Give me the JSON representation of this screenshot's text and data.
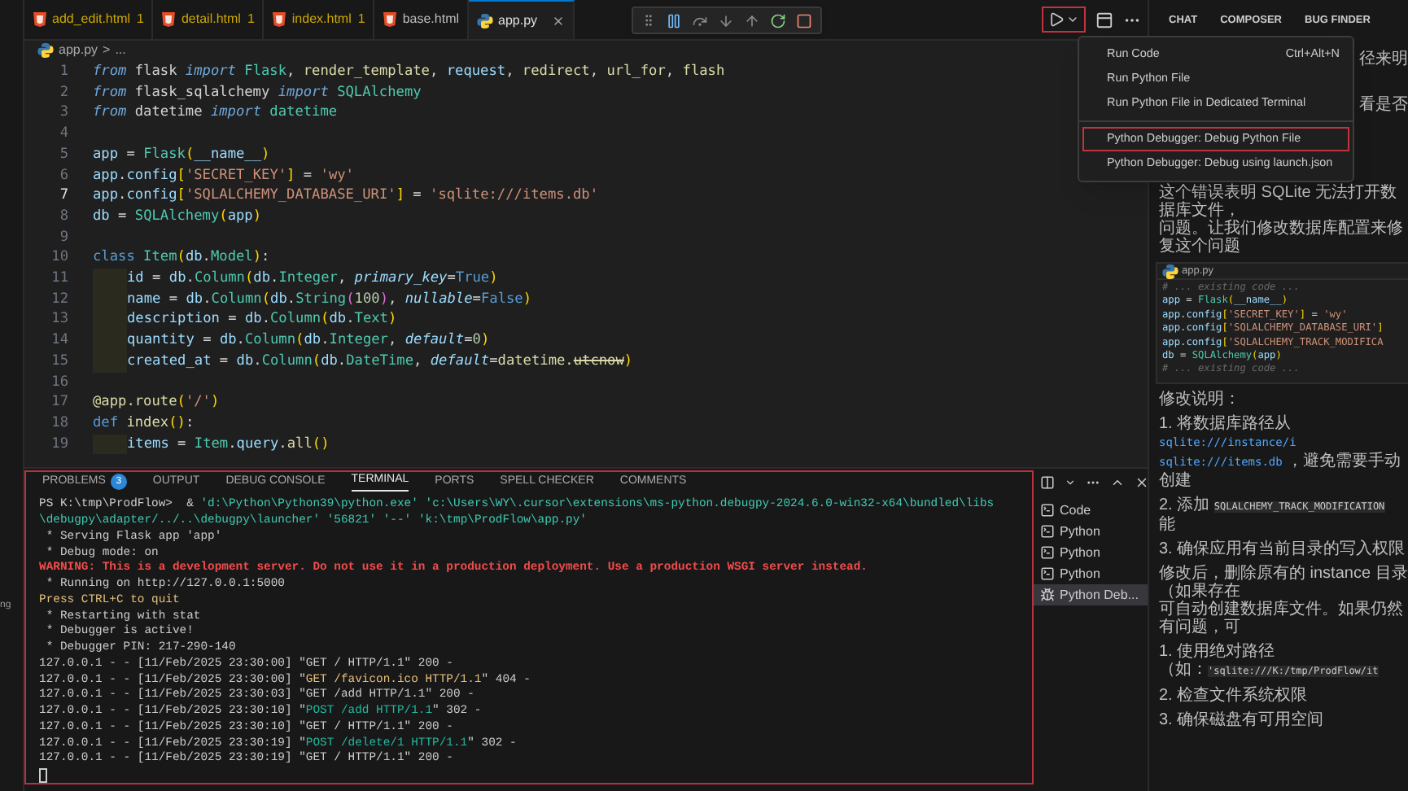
{
  "left_strip": {
    "text": "ng"
  },
  "editor_tabs": [
    {
      "label": "add_edit.html",
      "problems": "1",
      "kind": "html",
      "selected": false
    },
    {
      "label": "detail.html",
      "problems": "1",
      "kind": "html",
      "selected": false
    },
    {
      "label": "index.html",
      "problems": "1",
      "kind": "html",
      "selected": false
    },
    {
      "label": "base.html",
      "kind": "html",
      "selected": false
    },
    {
      "label": "app.py",
      "kind": "python",
      "selected": true
    }
  ],
  "breadcrumb": {
    "file": "app.py",
    "separator": ">",
    "rest": "..."
  },
  "code_lines": [
    {
      "number": "1",
      "current": false,
      "indented": false,
      "tokens": [
        {
          "text": "from",
          "kind": "kw"
        },
        {
          "text": " flask ",
          "kind": "p"
        },
        {
          "text": "import",
          "kind": "kw"
        },
        {
          "text": " Flask",
          "kind": "cls"
        },
        {
          "text": ", ",
          "kind": "p"
        },
        {
          "text": "render_template",
          "kind": "fn"
        },
        {
          "text": ", ",
          "kind": "p"
        },
        {
          "text": "request",
          "kind": "var"
        },
        {
          "text": ", ",
          "kind": "p"
        },
        {
          "text": "redirect",
          "kind": "fn"
        },
        {
          "text": ", ",
          "kind": "p"
        },
        {
          "text": "url_for",
          "kind": "fn"
        },
        {
          "text": ", ",
          "kind": "p"
        },
        {
          "text": "flash",
          "kind": "fn"
        }
      ]
    },
    {
      "number": "2",
      "current": false,
      "indented": false,
      "tokens": [
        {
          "text": "from",
          "kind": "kw"
        },
        {
          "text": " flask_sqlalchemy ",
          "kind": "p"
        },
        {
          "text": "import",
          "kind": "kw"
        },
        {
          "text": " SQLAlchemy",
          "kind": "cls"
        }
      ]
    },
    {
      "number": "3",
      "current": false,
      "indented": false,
      "tokens": [
        {
          "text": "from",
          "kind": "kw"
        },
        {
          "text": " datetime ",
          "kind": "p"
        },
        {
          "text": "import",
          "kind": "kw"
        },
        {
          "text": " datetime",
          "kind": "cls"
        }
      ]
    },
    {
      "number": "4",
      "current": false,
      "indented": false
    },
    {
      "number": "5",
      "current": false,
      "indented": false,
      "tokens": [
        {
          "text": "app",
          "kind": "var"
        },
        {
          "text": " = ",
          "kind": "p"
        },
        {
          "text": "Flask",
          "kind": "cls"
        },
        {
          "text": "(",
          "kind": "br"
        },
        {
          "text": "__name__",
          "kind": "var"
        },
        {
          "text": ")",
          "kind": "br"
        }
      ]
    },
    {
      "number": "6",
      "current": false,
      "indented": false,
      "tokens": [
        {
          "text": "app",
          "kind": "var"
        },
        {
          "text": ".",
          "kind": "p"
        },
        {
          "text": "config",
          "kind": "var"
        },
        {
          "text": "[",
          "kind": "br"
        },
        {
          "text": "'SECRET_KEY'",
          "kind": "str"
        },
        {
          "text": "]",
          "kind": "br"
        },
        {
          "text": " = ",
          "kind": "p"
        },
        {
          "text": "'wy'",
          "kind": "str"
        }
      ]
    },
    {
      "number": "7",
      "current": true,
      "indented": false,
      "tokens": [
        {
          "text": "app",
          "kind": "var"
        },
        {
          "text": ".",
          "kind": "p"
        },
        {
          "text": "config",
          "kind": "var"
        },
        {
          "text": "[",
          "kind": "br"
        },
        {
          "text": "'SQLALCHEMY_DATABASE_URI'",
          "kind": "str"
        },
        {
          "text": "]",
          "kind": "br"
        },
        {
          "text": " = ",
          "kind": "p"
        },
        {
          "text": "'sqlite:///items.db'",
          "kind": "str"
        }
      ]
    },
    {
      "number": "8",
      "current": false,
      "indented": false,
      "tokens": [
        {
          "text": "db",
          "kind": "var"
        },
        {
          "text": " = ",
          "kind": "p"
        },
        {
          "text": "SQLAlchemy",
          "kind": "cls"
        },
        {
          "text": "(",
          "kind": "br"
        },
        {
          "text": "app",
          "kind": "var"
        },
        {
          "text": ")",
          "kind": "br"
        }
      ]
    },
    {
      "number": "9",
      "current": false,
      "indented": false
    },
    {
      "number": "10",
      "current": false,
      "indented": false,
      "tokens": [
        {
          "text": "class ",
          "kind": "dk"
        },
        {
          "text": "Item",
          "kind": "cls"
        },
        {
          "text": "(",
          "kind": "br"
        },
        {
          "text": "db",
          "kind": "var"
        },
        {
          "text": ".",
          "kind": "p"
        },
        {
          "text": "Model",
          "kind": "cls"
        },
        {
          "text": ")",
          "kind": "br"
        },
        {
          "text": ":",
          "kind": "p"
        }
      ]
    },
    {
      "number": "11",
      "current": false,
      "indented": true,
      "tokens": [
        {
          "text": "id",
          "kind": "var"
        },
        {
          "text": " = ",
          "kind": "p"
        },
        {
          "text": "db",
          "kind": "var"
        },
        {
          "text": ".",
          "kind": "p"
        },
        {
          "text": "Column",
          "kind": "cls"
        },
        {
          "text": "(",
          "kind": "br"
        },
        {
          "text": "db",
          "kind": "var"
        },
        {
          "text": ".",
          "kind": "p"
        },
        {
          "text": "Integer",
          "kind": "cls"
        },
        {
          "text": ", ",
          "kind": "p"
        },
        {
          "text": "primary_key",
          "kind": "param"
        },
        {
          "text": "=",
          "kind": "p"
        },
        {
          "text": "True",
          "kind": "const"
        },
        {
          "text": ")",
          "kind": "br"
        }
      ]
    },
    {
      "number": "12",
      "current": false,
      "indented": true,
      "tokens": [
        {
          "text": "name",
          "kind": "var"
        },
        {
          "text": " = ",
          "kind": "p"
        },
        {
          "text": "db",
          "kind": "var"
        },
        {
          "text": ".",
          "kind": "p"
        },
        {
          "text": "Column",
          "kind": "cls"
        },
        {
          "text": "(",
          "kind": "br"
        },
        {
          "text": "db",
          "kind": "var"
        },
        {
          "text": ".",
          "kind": "p"
        },
        {
          "text": "String",
          "kind": "cls"
        },
        {
          "text": "(",
          "kind": "br2"
        },
        {
          "text": "100",
          "kind": "num"
        },
        {
          "text": ")",
          "kind": "br2"
        },
        {
          "text": ", ",
          "kind": "p"
        },
        {
          "text": "nullable",
          "kind": "param"
        },
        {
          "text": "=",
          "kind": "p"
        },
        {
          "text": "False",
          "kind": "const"
        },
        {
          "text": ")",
          "kind": "br"
        }
      ]
    },
    {
      "number": "13",
      "current": false,
      "indented": true,
      "tokens": [
        {
          "text": "description",
          "kind": "var"
        },
        {
          "text": " = ",
          "kind": "p"
        },
        {
          "text": "db",
          "kind": "var"
        },
        {
          "text": ".",
          "kind": "p"
        },
        {
          "text": "Column",
          "kind": "cls"
        },
        {
          "text": "(",
          "kind": "br"
        },
        {
          "text": "db",
          "kind": "var"
        },
        {
          "text": ".",
          "kind": "p"
        },
        {
          "text": "Text",
          "kind": "cls"
        },
        {
          "text": ")",
          "kind": "br"
        }
      ]
    },
    {
      "number": "14",
      "current": false,
      "indented": true,
      "tokens": [
        {
          "text": "quantity",
          "kind": "var"
        },
        {
          "text": " = ",
          "kind": "p"
        },
        {
          "text": "db",
          "kind": "var"
        },
        {
          "text": ".",
          "kind": "p"
        },
        {
          "text": "Column",
          "kind": "cls"
        },
        {
          "text": "(",
          "kind": "br"
        },
        {
          "text": "db",
          "kind": "var"
        },
        {
          "text": ".",
          "kind": "p"
        },
        {
          "text": "Integer",
          "kind": "cls"
        },
        {
          "text": ", ",
          "kind": "p"
        },
        {
          "text": "default",
          "kind": "param"
        },
        {
          "text": "=",
          "kind": "p"
        },
        {
          "text": "0",
          "kind": "num"
        },
        {
          "text": ")",
          "kind": "br"
        }
      ]
    },
    {
      "number": "15",
      "current": false,
      "indented": true,
      "tokens": [
        {
          "text": "created_at",
          "kind": "var"
        },
        {
          "text": " = ",
          "kind": "p"
        },
        {
          "text": "db",
          "kind": "var"
        },
        {
          "text": ".",
          "kind": "p"
        },
        {
          "text": "Column",
          "kind": "cls"
        },
        {
          "text": "(",
          "kind": "br"
        },
        {
          "text": "db",
          "kind": "var"
        },
        {
          "text": ".",
          "kind": "p"
        },
        {
          "text": "DateTime",
          "kind": "cls"
        },
        {
          "text": ", ",
          "kind": "p"
        },
        {
          "text": "default",
          "kind": "param"
        },
        {
          "text": "=",
          "kind": "p"
        },
        {
          "text": "datetime.",
          "kind": "fn"
        },
        {
          "text": "utcnow",
          "kind": "strike"
        },
        {
          "text": ")",
          "kind": "br"
        }
      ]
    },
    {
      "number": "16",
      "current": false,
      "indented": false
    },
    {
      "number": "17",
      "current": false,
      "indented": false,
      "tokens": [
        {
          "text": "@app.route",
          "kind": "fn"
        },
        {
          "text": "(",
          "kind": "br"
        },
        {
          "text": "'/'",
          "kind": "str"
        },
        {
          "text": ")",
          "kind": "br"
        }
      ]
    },
    {
      "number": "18",
      "current": false,
      "indented": false,
      "tokens": [
        {
          "text": "def ",
          "kind": "dk"
        },
        {
          "text": "index",
          "kind": "fn"
        },
        {
          "text": "()",
          "kind": "br"
        },
        {
          "text": ":",
          "kind": "p"
        }
      ]
    },
    {
      "number": "19",
      "current": false,
      "indented": true,
      "tokens": [
        {
          "text": "items",
          "kind": "var"
        },
        {
          "text": " = ",
          "kind": "p"
        },
        {
          "text": "Item",
          "kind": "cls"
        },
        {
          "text": ".",
          "kind": "p"
        },
        {
          "text": "query",
          "kind": "var"
        },
        {
          "text": ".",
          "kind": "p"
        },
        {
          "text": "all",
          "kind": "fn"
        },
        {
          "text": "()",
          "kind": "br"
        }
      ]
    }
  ],
  "panel_tabs": [
    {
      "label": "PROBLEMS",
      "badge": "3",
      "selected": false
    },
    {
      "label": "OUTPUT",
      "selected": false
    },
    {
      "label": "DEBUG CONSOLE",
      "selected": false
    },
    {
      "label": "TERMINAL",
      "selected": true
    },
    {
      "label": "PORTS",
      "selected": false
    },
    {
      "label": "SPELL CHECKER",
      "selected": false
    },
    {
      "label": "COMMENTS",
      "selected": false
    }
  ],
  "terminal_lines": [
    [
      {
        "text": "PS K:\\tmp\\ProdFlow>  & ",
        "kind": "plain"
      },
      {
        "text": "'d:\\Python\\Python39\\python.exe' ",
        "kind": "string"
      },
      {
        "text": "'c:\\Users\\WY\\.cursor\\extensions\\ms-python.debugpy-2024.6.0-win32-x64\\bundled\\libs",
        "kind": "string"
      }
    ],
    [
      {
        "text": "\\debugpy\\adapter/../..\\debugpy\\launcher' ",
        "kind": "string"
      },
      {
        "text": "'56821' ",
        "kind": "string"
      },
      {
        "text": "'--' ",
        "kind": "string"
      },
      {
        "text": "'k:\\tmp\\ProdFlow\\app.py'",
        "kind": "string"
      }
    ],
    [
      {
        "text": " * Serving Flask app 'app'",
        "kind": "plain"
      }
    ],
    [
      {
        "text": " * Debug mode: on",
        "kind": "plain"
      }
    ],
    [
      {
        "text": "WARNING: This is a development server. Do not use it in a production deployment. Use a production WSGI server instead.",
        "kind": "error"
      }
    ],
    [
      {
        "text": " * Running on http://127.0.0.1:5000",
        "kind": "plain"
      }
    ],
    [
      {
        "text": "Press CTRL+C to quit",
        "kind": "yellow"
      }
    ],
    [
      {
        "text": " * Restarting with stat",
        "kind": "plain"
      }
    ],
    [
      {
        "text": " * Debugger is active!",
        "kind": "plain"
      }
    ],
    [
      {
        "text": " * Debugger PIN: 217-290-140",
        "kind": "plain"
      }
    ],
    [
      {
        "text": "127.0.0.1 - - [11/Feb/2025 23:30:00] \"GET / HTTP/1.1\" 200 -",
        "kind": "plain"
      }
    ],
    [
      {
        "text": "127.0.0.1 - - [11/Feb/2025 23:30:00] \"",
        "kind": "plain"
      },
      {
        "text": "GET /favicon.ico HTTP/1.1",
        "kind": "yellow"
      },
      {
        "text": "\" 404 -",
        "kind": "plain"
      }
    ],
    [
      {
        "text": "127.0.0.1 - - [11/Feb/2025 23:30:03] \"GET /add HTTP/1.1\" 200 -",
        "kind": "plain"
      }
    ],
    [
      {
        "text": "127.0.0.1 - - [11/Feb/2025 23:30:10] \"",
        "kind": "plain"
      },
      {
        "text": "POST /add HTTP/1.1",
        "kind": "green"
      },
      {
        "text": "\" 302 -",
        "kind": "plain"
      }
    ],
    [
      {
        "text": "127.0.0.1 - - [11/Feb/2025 23:30:10] \"GET / HTTP/1.1\" 200 -",
        "kind": "plain"
      }
    ],
    [
      {
        "text": "127.0.0.1 - - [11/Feb/2025 23:30:19] \"",
        "kind": "plain"
      },
      {
        "text": "POST /delete/1 HTTP/1.1",
        "kind": "green"
      },
      {
        "text": "\" 302 -",
        "kind": "plain"
      }
    ],
    [
      {
        "text": "127.0.0.1 - - [11/Feb/2025 23:30:19] \"GET / HTTP/1.1\" 200 -",
        "kind": "plain"
      }
    ]
  ],
  "terminal_list": [
    {
      "label": "Code",
      "kind": "terminal",
      "selected": false
    },
    {
      "label": "Python",
      "kind": "terminal",
      "selected": false
    },
    {
      "label": "Python",
      "kind": "terminal",
      "selected": false
    },
    {
      "label": "Python",
      "kind": "terminal",
      "selected": false
    },
    {
      "label": "Python Deb...",
      "kind": "debug",
      "selected": true
    }
  ],
  "chat_tabs": [
    "CHAT",
    "COMPOSER",
    "BUG FINDER"
  ],
  "chat_fragments": [
    "径来明",
    "看是否"
  ],
  "chat_blocks": [
    {
      "kind": "text",
      "lines": [
        [
          {
            "text": "这个错误表明 SQLite 无法打开数据库文件，",
            "kind": "plain"
          }
        ],
        [
          {
            "text": "问题。让我们修改数据库配置来修复这个问题",
            "kind": "plain"
          }
        ]
      ]
    },
    {
      "kind": "code",
      "title": "app.py",
      "lines": [
        [
          {
            "text": "# ... existing code ...",
            "kind": "comment"
          }
        ],
        [
          {
            "text": "app",
            "kind": "var"
          },
          {
            "text": " = ",
            "kind": "p"
          },
          {
            "text": "Flask",
            "kind": "cls"
          },
          {
            "text": "(",
            "kind": "br"
          },
          {
            "text": "__name__",
            "kind": "var"
          },
          {
            "text": ")",
            "kind": "br"
          }
        ],
        [
          {
            "text": "app",
            "kind": "var"
          },
          {
            "text": ".",
            "kind": "p"
          },
          {
            "text": "config",
            "kind": "var"
          },
          {
            "text": "[",
            "kind": "br"
          },
          {
            "text": "'SECRET_KEY'",
            "kind": "str"
          },
          {
            "text": "]",
            "kind": "br"
          },
          {
            "text": " = ",
            "kind": "p"
          },
          {
            "text": "'wy'",
            "kind": "str"
          }
        ],
        [
          {
            "text": "app",
            "kind": "var"
          },
          {
            "text": ".",
            "kind": "p"
          },
          {
            "text": "config",
            "kind": "var"
          },
          {
            "text": "[",
            "kind": "br"
          },
          {
            "text": "'SQLALCHEMY_DATABASE_URI'",
            "kind": "str"
          },
          {
            "text": "]",
            "kind": "br"
          }
        ],
        [
          {
            "text": "app",
            "kind": "var"
          },
          {
            "text": ".",
            "kind": "p"
          },
          {
            "text": "config",
            "kind": "var"
          },
          {
            "text": "[",
            "kind": "br"
          },
          {
            "text": "'SQLALCHEMY_TRACK_MODIFICA",
            "kind": "str"
          }
        ],
        [
          {
            "text": "db",
            "kind": "var"
          },
          {
            "text": " = ",
            "kind": "p"
          },
          {
            "text": "SQLAlchemy",
            "kind": "cls"
          },
          {
            "text": "(",
            "kind": "br"
          },
          {
            "text": "app",
            "kind": "var"
          },
          {
            "text": ")",
            "kind": "br"
          }
        ],
        [
          {
            "text": "# ... existing code ...",
            "kind": "comment"
          }
        ]
      ]
    },
    {
      "kind": "text",
      "lines": [
        [
          {
            "text": "修改说明：",
            "kind": "plain"
          }
        ]
      ]
    },
    {
      "kind": "text",
      "lines": [
        [
          {
            "text": "1. 将数据库路径从 ",
            "kind": "plain"
          },
          {
            "text": "sqlite:///instance/i",
            "kind": "path"
          }
        ],
        [
          {
            "text": "sqlite:///items.db",
            "kind": "path"
          },
          {
            "text": " ，避免需要手动创建",
            "kind": "plain"
          }
        ]
      ]
    },
    {
      "kind": "text",
      "lines": [
        [
          {
            "text": "2. 添加 ",
            "kind": "plain"
          },
          {
            "text": "SQLALCHEMY_TRACK_MODIFICATION",
            "kind": "code"
          }
        ],
        [
          {
            "text": "能",
            "kind": "plain"
          }
        ]
      ]
    },
    {
      "kind": "text",
      "lines": [
        [
          {
            "text": "3. 确保应用有当前目录的写入权限",
            "kind": "plain"
          }
        ]
      ]
    },
    {
      "kind": "text",
      "lines": [
        [
          {
            "text": "修改后，删除原有的 instance 目录（如果存在",
            "kind": "plain"
          }
        ],
        [
          {
            "text": "可自动创建数据库文件。如果仍然有问题，可",
            "kind": "plain"
          }
        ]
      ]
    },
    {
      "kind": "text",
      "lines": [
        [
          {
            "text": "1. 使用绝对路径",
            "kind": "plain"
          }
        ],
        [
          {
            "text": "（如：",
            "kind": "plain"
          },
          {
            "text": "'sqlite:///K:/tmp/ProdFlow/it",
            "kind": "code"
          }
        ]
      ]
    },
    {
      "kind": "text",
      "lines": [
        [
          {
            "text": "2. 检查文件系统权限",
            "kind": "plain"
          }
        ]
      ]
    },
    {
      "kind": "text",
      "lines": [
        [
          {
            "text": "3. 确保磁盘有可用空间",
            "kind": "plain"
          }
        ]
      ]
    }
  ],
  "run_menu": {
    "groups": [
      [
        {
          "label": "Run Code",
          "shortcut": "Ctrl+Alt+N",
          "highlighted": false
        },
        {
          "label": "Run Python File",
          "highlighted": false
        },
        {
          "label": "Run Python File in Dedicated Terminal",
          "highlighted": false
        }
      ],
      [
        {
          "label": "Python Debugger: Debug Python File",
          "highlighted": true
        },
        {
          "label": "Python Debugger: Debug using launch.json",
          "highlighted": false
        }
      ]
    ]
  }
}
